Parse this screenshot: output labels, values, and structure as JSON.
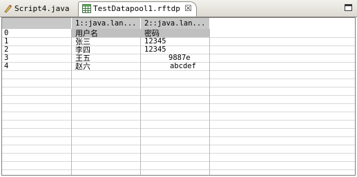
{
  "tabs": [
    {
      "label": "Script4.java",
      "icon": "java-file-icon",
      "active": false
    },
    {
      "label": "TestDatapool1.rftdp",
      "icon": "datapool-table-icon",
      "active": true,
      "close_glyph": "☒"
    }
  ],
  "table": {
    "columns": [
      "",
      "1::java.lan...",
      "2::java.lan..."
    ],
    "rows": [
      {
        "index": "0",
        "c1": "用户名",
        "c2": "密码"
      },
      {
        "index": "1",
        "c1": "张三",
        "c2": "12345"
      },
      {
        "index": "2",
        "c1": "李四",
        "c2": "12345"
      },
      {
        "index": "3",
        "c1": "王五",
        "c2": "9887e"
      },
      {
        "index": "4",
        "c1": "赵六",
        "c2": "abcdef"
      }
    ]
  },
  "colors": {
    "header_bg": "#c8c8c8",
    "grid_line": "#d8d8d8",
    "selected_row": "#c0c0c0"
  }
}
